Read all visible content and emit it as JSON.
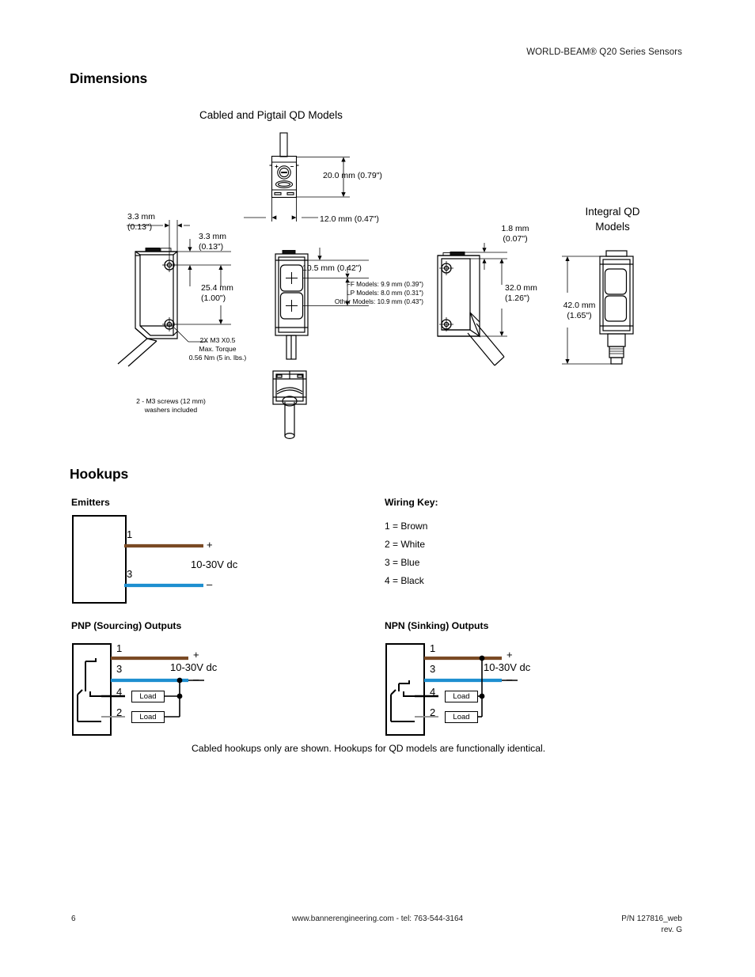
{
  "header": {
    "product_line": "WORLD-BEAM® Q20 Series Sensors"
  },
  "dimensions_section": {
    "title": "Dimensions",
    "subtitle_cabled": "Cabled and Pigtail QD Models",
    "subtitle_integral": "Integral QD\nModels",
    "labels": {
      "depth_20mm": "20.0 mm (0.79\")",
      "width_12mm": "12.0 mm (0.47\")",
      "offset_left_33mm": "3.3 mm\n(0.13\")",
      "offset_top_33mm": "3.3 mm\n(0.13\")",
      "hole_spacing_254mm": "25.4 mm\n(1.00\")",
      "screw_spec": "2X M3 X0.5\nMax. Torque\n0.56 Nm (5 in. lbs.)",
      "screws_included": "2 - M3 screws (12 mm)\nwashers included",
      "lens_offset_105mm": "10.5 mm (0.42\")",
      "ff_models": "FF Models: 9.9 mm (0.39\")",
      "lp_models": "LP Models: 8.0 mm (0.31\")",
      "other_models": "Other Models: 10.9 mm (0.43\")",
      "top_18mm": "1.8 mm\n(0.07\")",
      "height_32mm": "32.0 mm\n(1.26\")",
      "height_42mm": "42.0 mm\n(1.65\")"
    }
  },
  "hookups_section": {
    "title": "Hookups",
    "emitters": {
      "label": "Emitters",
      "pins": [
        "1",
        "3"
      ],
      "plus": "+",
      "minus": "–",
      "voltage": "10-30V dc"
    },
    "pnp": {
      "label": "PNP (Sourcing) Outputs",
      "pins": [
        "1",
        "3",
        "4",
        "2"
      ],
      "plus": "+",
      "minus": "–",
      "voltage": "10-30V dc",
      "load_label": "Load"
    },
    "npn": {
      "label": "NPN (Sinking) Outputs",
      "pins": [
        "1",
        "3",
        "4",
        "2"
      ],
      "plus": "+",
      "minus": "–",
      "voltage": "10-30V dc",
      "load_label": "Load"
    },
    "wiring_key": {
      "title": "Wiring Key:",
      "entries": [
        "1 = Brown",
        "2 = White",
        "3 = Blue",
        "4 = Black"
      ]
    },
    "caption": "Cabled hookups only are shown. Hookups for QD models are functionally identical."
  },
  "footer": {
    "page_number": "6",
    "contact": "www.bannerengineering.com - tel: 763-544-3164",
    "part_number": "P/N 127816_web",
    "revision": "rev. G"
  },
  "colors": {
    "wire_brown": "#7a4a24",
    "wire_blue": "#1e8fd0",
    "line_black": "#000000",
    "text": "#000000"
  }
}
